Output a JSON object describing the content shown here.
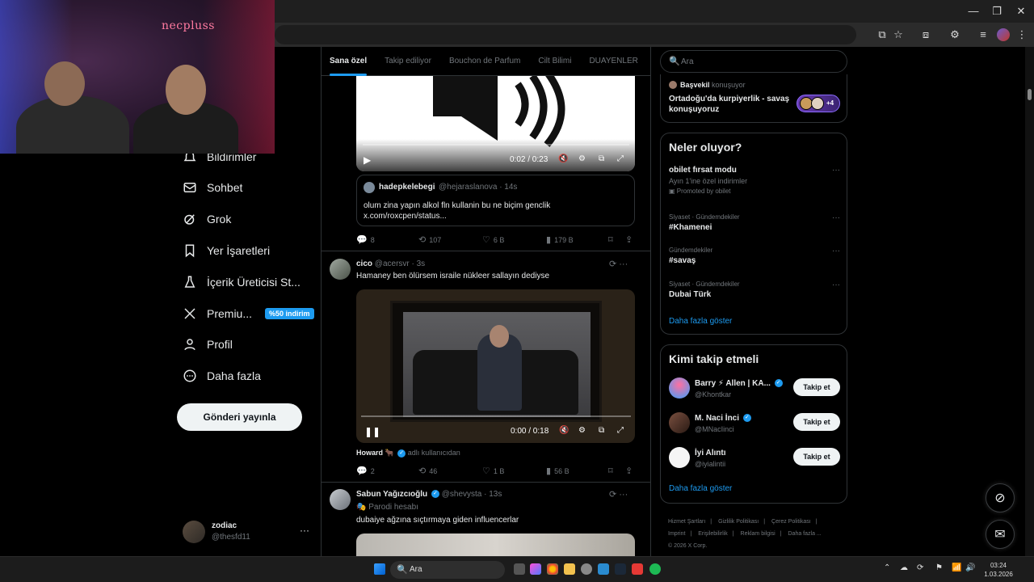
{
  "webcam": {
    "brand": "necpluss"
  },
  "nav": {
    "items": [
      {
        "label": "Bildirimler",
        "icon": "bell-icon"
      },
      {
        "label": "Sohbet",
        "icon": "mail-icon"
      },
      {
        "label": "Grok",
        "icon": "grok-icon"
      },
      {
        "label": "Yer İşaretleri",
        "icon": "bookmark-icon"
      },
      {
        "label": "İçerik Üreticisi St...",
        "icon": "flask-icon"
      },
      {
        "label": "Premiu...",
        "icon": "x-logo-icon"
      },
      {
        "label": "Profil",
        "icon": "person-icon"
      },
      {
        "label": "Daha fazla",
        "icon": "more-circle-icon"
      }
    ],
    "premium_badge": "%50 indirim",
    "post_button": "Gönderi yayınla"
  },
  "account": {
    "name": "zodiac",
    "handle": "@thesfd11",
    "more": "···"
  },
  "tabs": [
    "Sana özel",
    "Takip ediliyor",
    "Bouchon de Parfum",
    "Cilt Bilimi",
    "DUAYENLER"
  ],
  "post1": {
    "video_time": "0:02 / 0:23",
    "quote": {
      "name": "hadepkelebegi",
      "meta": "@hejaraslanova · 14s",
      "text_line1": "olum zina yapın alkol fln kullanin bu ne biçim genclik",
      "text_line2": "x.com/roxcpen/status..."
    },
    "actions": {
      "replies": "8",
      "reposts": "107",
      "likes": "6 B",
      "views": "179 B"
    }
  },
  "post2": {
    "name": "cico",
    "meta": "@acersvr · 3s",
    "text": "Hamaney ben ölürsem israile nükleer sallayın dediyse",
    "video_time": "0:00 / 0:18",
    "source_name": "Howard 🐂",
    "source_suffix": "adlı kullanıcıdan",
    "actions": {
      "replies": "2",
      "reposts": "46",
      "likes": "1 B",
      "views": "56 B"
    }
  },
  "post3": {
    "name": "Sabun Yağızcıoğlu",
    "meta": "@shevysta · 13s",
    "parody": "Parodi hesabı",
    "text": "dubaiye ağzına sıçtırmaya giden influencerlar"
  },
  "right": {
    "search_placeholder": "Ara",
    "spaces": {
      "host": "Başvekil",
      "host_suffix": "konuşuyor",
      "title": "Ortadoğu'da kurpiyerlik - savaş konuşuyoruz",
      "listeners_more": "+4"
    },
    "trends_title": "Neler oluyor?",
    "trends": [
      {
        "cat": "",
        "title": "obilet fırsat modu",
        "sub": "Ayın 1'ine özel indirimler",
        "promo": "Promoted by obilet"
      },
      {
        "cat": "Siyaset · Gündemdekiler",
        "title": "#Khamenei",
        "sub": "",
        "promo": ""
      },
      {
        "cat": "Gündemdekiler",
        "title": "#savaş",
        "sub": "",
        "promo": ""
      },
      {
        "cat": "Siyaset · Gündemdekiler",
        "title": "Dubai Türk",
        "sub": "",
        "promo": ""
      }
    ],
    "show_more": "Daha fazla göster",
    "who_title": "Kimi takip etmeli",
    "who": [
      {
        "name": "Barry ⚡ Allen | KA...",
        "handle": "@Khontkar",
        "button": "Takip et"
      },
      {
        "name": "M. Naci İnci",
        "handle": "@MNacIinci",
        "button": "Takip et"
      },
      {
        "name": "İyi Alıntı",
        "handle": "@iyialintii",
        "button": "Takip et"
      }
    ],
    "who_show_more": "Daha fazla göster",
    "footer": [
      "Hizmet Şartları",
      "|",
      "Gizlilik Politikası",
      "|",
      "Çerez Politikası",
      "|",
      "Imprint",
      "|",
      "Erişilebilirlik",
      "|",
      "Reklam bilgisi",
      "|",
      "Daha fazla ...",
      "© 2026 X Corp."
    ]
  },
  "taskbar": {
    "search_placeholder": "Ara",
    "time": "03:24",
    "date": "1.03.2026"
  },
  "colors": {
    "accent": "#1d9bf0",
    "border": "#2f3336",
    "muted": "#71767b",
    "text": "#e7e9ea"
  }
}
